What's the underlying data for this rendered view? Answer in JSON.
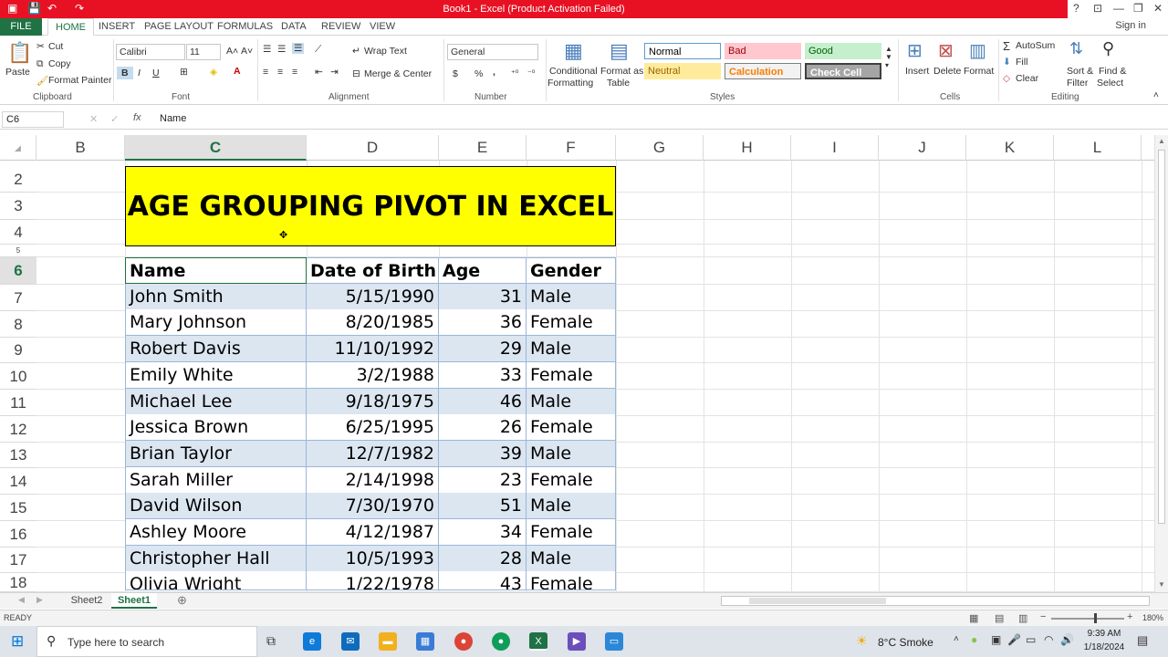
{
  "titlebar": {
    "title": "Book1 - Excel (Product Activation Failed)",
    "help": "?",
    "minimize": "—",
    "restore": "❐",
    "close": "✕"
  },
  "tabs": {
    "file": "FILE",
    "items": [
      "HOME",
      "INSERT",
      "PAGE LAYOUT",
      "FORMULAS",
      "DATA",
      "REVIEW",
      "VIEW"
    ],
    "signin": "Sign in"
  },
  "ribbon": {
    "clipboard": {
      "paste": "Paste",
      "cut": "Cut",
      "copy": "Copy",
      "format_painter": "Format Painter",
      "label": "Clipboard"
    },
    "font": {
      "name": "Calibri",
      "size": "11",
      "bold": "B",
      "italic": "I",
      "underline": "U",
      "label": "Font"
    },
    "alignment": {
      "wrap": "Wrap Text",
      "merge": "Merge & Center",
      "label": "Alignment"
    },
    "number": {
      "format": "General",
      "currency": "$",
      "percent": "%",
      "comma": ",",
      "label": "Number"
    },
    "styles": {
      "conditional": "Conditional",
      "conditional2": "Formatting",
      "format_as": "Format as",
      "format_as2": "Table",
      "normal": "Normal",
      "bad": "Bad",
      "good": "Good",
      "neutral": "Neutral",
      "calculation": "Calculation",
      "check_cell": "Check Cell",
      "label": "Styles"
    },
    "cells": {
      "insert": "Insert",
      "delete": "Delete",
      "format": "Format",
      "label": "Cells"
    },
    "editing": {
      "autosum": "AutoSum",
      "fill": "Fill",
      "clear": "Clear",
      "sort": "Sort &",
      "sort2": "Filter",
      "find": "Find &",
      "find2": "Select",
      "label": "Editing"
    }
  },
  "formula_bar": {
    "namebox": "C6",
    "fx": "fx",
    "content": "Name"
  },
  "columns": [
    "B",
    "C",
    "D",
    "E",
    "F",
    "G",
    "H",
    "I",
    "J",
    "K",
    "L"
  ],
  "rows": [
    "2",
    "3",
    "4",
    "5",
    "6",
    "7",
    "8",
    "9",
    "10",
    "11",
    "12",
    "13",
    "14",
    "15",
    "16",
    "17",
    "18"
  ],
  "sheet_title": "AGE GROUPING PIVOT IN EXCEL",
  "table": {
    "headers": [
      "Name",
      "Date of Birth",
      "Age",
      "Gender"
    ],
    "rows": [
      [
        "John Smith",
        "5/15/1990",
        "31",
        "Male"
      ],
      [
        "Mary Johnson",
        "8/20/1985",
        "36",
        "Female"
      ],
      [
        "Robert Davis",
        "11/10/1992",
        "29",
        "Male"
      ],
      [
        "Emily White",
        "3/2/1988",
        "33",
        "Female"
      ],
      [
        "Michael Lee",
        "9/18/1975",
        "46",
        "Male"
      ],
      [
        "Jessica Brown",
        "6/25/1995",
        "26",
        "Female"
      ],
      [
        "Brian Taylor",
        "12/7/1982",
        "39",
        "Male"
      ],
      [
        "Sarah Miller",
        "2/14/1998",
        "23",
        "Female"
      ],
      [
        "David Wilson",
        "7/30/1970",
        "51",
        "Male"
      ],
      [
        "Ashley Moore",
        "4/12/1987",
        "34",
        "Female"
      ],
      [
        "Christopher Hall",
        "10/5/1993",
        "28",
        "Male"
      ],
      [
        "Olivia Wright",
        "1/22/1978",
        "43",
        "Female"
      ]
    ]
  },
  "sheets": [
    "Sheet2",
    "Sheet1"
  ],
  "status": {
    "ready": "READY",
    "zoom": "180%"
  },
  "taskbar": {
    "search": "Type here to search",
    "weather": "8°C  Smoke",
    "time": "9:39 AM",
    "date": "1/18/2024"
  },
  "colors": {
    "excel_green": "#1f7244",
    "title_red": "#e81123",
    "title_yellow": "#ffff00",
    "band_blue": "#dce6f1"
  }
}
